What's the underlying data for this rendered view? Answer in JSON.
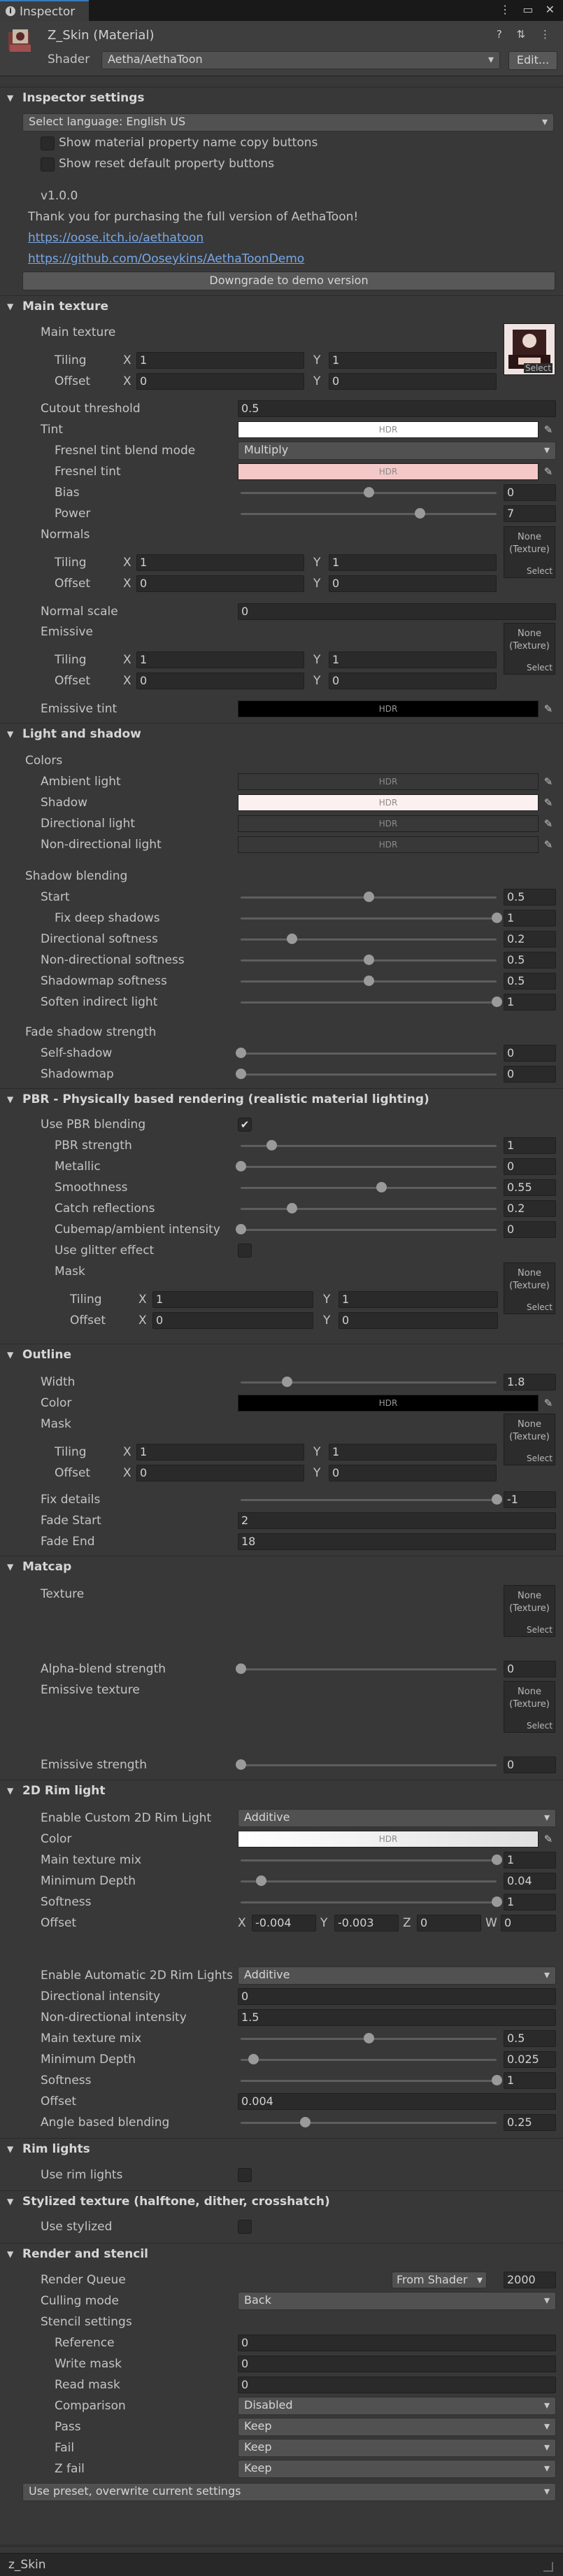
{
  "tab": {
    "title": "Inspector"
  },
  "header": {
    "material_name": "Z_Skin (Material)",
    "shader_label": "Shader",
    "shader_value": "Aetha/AethaToon",
    "edit_button": "Edit..."
  },
  "colors": {
    "tint": "#ffffff",
    "fresnel_tint": "#f5c8c8",
    "emissive_tint": "#000000",
    "rim_color_start": "#ffffff",
    "rim_color_end": "#e0e0e0"
  },
  "inspector_settings": {
    "title": "Inspector settings",
    "language": "Select language: English US",
    "opt_copy": "Show material property name copy buttons",
    "opt_reset": "Show reset default property buttons",
    "version": "v1.0.0",
    "thanks": "Thank you for purchasing the full version of AethaToon!",
    "link1": "https://oose.itch.io/aethatoon",
    "link2": "https://github.com/Ooseykins/AethaToonDemo",
    "downgrade": "Downgrade to demo version"
  },
  "main_texture": {
    "title": "Main texture",
    "main_label": "Main texture",
    "tiling": "Tiling",
    "offset": "Offset",
    "x": "X",
    "y": "Y",
    "tiling_x": "1",
    "tiling_y": "1",
    "offset_x": "0",
    "offset_y": "0",
    "select": "Select",
    "cutout_label": "Cutout threshold",
    "cutout": "0.5",
    "tint_label": "Tint",
    "hdr": "HDR",
    "fresnel_mode_label": "Fresnel tint blend mode",
    "fresnel_mode": "Multiply",
    "fresnel_tint_label": "Fresnel tint",
    "bias_label": "Bias",
    "bias": "0",
    "power_label": "Power",
    "power": "7",
    "normals_label": "Normals",
    "none_texture": "None (Texture)",
    "normal_tiling_x": "1",
    "normal_tiling_y": "1",
    "normal_offset_x": "0",
    "normal_offset_y": "0",
    "normal_scale_label": "Normal scale",
    "normal_scale": "0",
    "emissive_label": "Emissive",
    "em_tiling_x": "1",
    "em_tiling_y": "1",
    "em_offset_x": "0",
    "em_offset_y": "0",
    "emissive_tint_label": "Emissive tint"
  },
  "light_shadow": {
    "title": "Light and shadow",
    "colors_label": "Colors",
    "ambient": "Ambient light",
    "shadow": "Shadow",
    "directional": "Directional light",
    "nondirectional": "Non-directional light",
    "hdr": "HDR",
    "blending_label": "Shadow blending",
    "start_label": "Start",
    "start": "0.5",
    "fix_label": "Fix deep shadows",
    "fix": "1",
    "dir_soft_label": "Directional softness",
    "dir_soft": "0.2",
    "nondir_soft_label": "Non-directional softness",
    "nondir_soft": "0.5",
    "map_soft_label": "Shadowmap softness",
    "map_soft": "0.5",
    "soften_label": "Soften indirect light",
    "soften": "1",
    "fade_label": "Fade shadow strength",
    "self_label": "Self-shadow",
    "self": "0",
    "shadowmap_label": "Shadowmap",
    "shadowmap": "0"
  },
  "pbr": {
    "title": "PBR - Physically based rendering (realistic material lighting)",
    "use_label": "Use PBR blending",
    "check": "✔",
    "strength_label": "PBR strength",
    "strength": "1",
    "metallic_label": "Metallic",
    "metallic": "0",
    "smooth_label": "Smoothness",
    "smooth": "0.55",
    "catch_label": "Catch reflections",
    "catch": "0.2",
    "cube_label": "Cubemap/ambient intensity",
    "cube": "0",
    "glitter_label": "Use glitter effect",
    "mask_label": "Mask",
    "none_texture": "None (Texture)",
    "tiling": "Tiling",
    "offset": "Offset",
    "x": "X",
    "y": "Y",
    "tiling_x": "1",
    "tiling_y": "1",
    "offset_x": "0",
    "offset_y": "0",
    "select": "Select"
  },
  "outline": {
    "title": "Outline",
    "width_label": "Width",
    "width": "1.8",
    "color_label": "Color",
    "hdr": "HDR",
    "mask_label": "Mask",
    "none_texture": "None (Texture)",
    "tiling": "Tiling",
    "offset": "Offset",
    "x": "X",
    "y": "Y",
    "tiling_x": "1",
    "tiling_y": "1",
    "offset_x": "0",
    "offset_y": "0",
    "select": "Select",
    "fix_label": "Fix details",
    "fix": "-1",
    "fade_start_label": "Fade Start",
    "fade_start": "2",
    "fade_end_label": "Fade End",
    "fade_end": "18"
  },
  "matcap": {
    "title": "Matcap",
    "texture_label": "Texture",
    "none_texture": "None (Texture)",
    "select": "Select",
    "alpha_label": "Alpha-blend strength",
    "alpha": "0",
    "emissive_label": "Emissive texture",
    "em_strength_label": "Emissive strength",
    "em_strength": "0"
  },
  "rim2d": {
    "title": "2D Rim light",
    "enable_label": "Enable Custom 2D Rim Light",
    "enable_mode": "Additive",
    "color_label": "Color",
    "hdr": "HDR",
    "mix_label": "Main texture mix",
    "mix": "1",
    "depth_label": "Minimum Depth",
    "depth": "0.04",
    "soft_label": "Softness",
    "soft": "1",
    "offset_label": "Offset",
    "x": "X",
    "y": "Y",
    "z": "Z",
    "w": "W",
    "ox": "-0.004",
    "oy": "-0.003",
    "oz": "0",
    "ow": "0",
    "auto_label": "Enable Automatic 2D Rim Lights",
    "auto_mode": "Additive",
    "dir_label": "Directional intensity",
    "dir": "0",
    "nondir_label": "Non-directional intensity",
    "nondir": "1.5",
    "mix2_label": "Main texture mix",
    "mix2": "0.5",
    "depth2_label": "Minimum Depth",
    "depth2": "0.025",
    "soft2_label": "Softness",
    "soft2": "1",
    "offset2_label": "Offset",
    "offset2": "0.004",
    "angle_label": "Angle based blending",
    "angle": "0.25"
  },
  "rim": {
    "title": "Rim lights",
    "use_label": "Use rim lights"
  },
  "stylized": {
    "title": "Stylized texture (halftone, dither, crosshatch)",
    "use_label": "Use stylized"
  },
  "render": {
    "title": "Render and stencil",
    "queue_label": "Render Queue",
    "queue_mode": "From Shader",
    "queue": "2000",
    "cull_label": "Culling mode",
    "cull": "Back",
    "stencil_label": "Stencil settings",
    "ref_label": "Reference",
    "ref": "0",
    "write_label": "Write mask",
    "write": "0",
    "read_label": "Read mask",
    "read": "0",
    "comp_label": "Comparison",
    "comp": "Disabled",
    "pass_label": "Pass",
    "pass": "Keep",
    "fail_label": "Fail",
    "fail": "Keep",
    "zfail_label": "Z fail",
    "zfail": "Keep",
    "preset": "Use preset, overwrite current settings"
  },
  "footer": {
    "name": "z_Skin"
  },
  "sliders": {
    "bias": 0.5,
    "power": 0.7,
    "start": 0.5,
    "fix": 1.0,
    "dir_soft": 0.2,
    "nondir_soft": 0.5,
    "map_soft": 0.5,
    "soften": 1.0,
    "self": 0.0,
    "shadowmap": 0.0,
    "pbr_strength": 0.12,
    "metallic": 0.0,
    "smooth": 0.55,
    "catch": 0.2,
    "cube": 0.0,
    "outline_width": 0.18,
    "outline_fix": 1.0,
    "matcap_alpha": 0.0,
    "matcap_em": 0.0,
    "rim_mix": 1.0,
    "rim_depth": 0.08,
    "rim_soft": 1.0,
    "rim_mix2": 0.5,
    "rim_depth2": 0.05,
    "rim_soft2": 1.0,
    "rim_angle": 0.25
  }
}
